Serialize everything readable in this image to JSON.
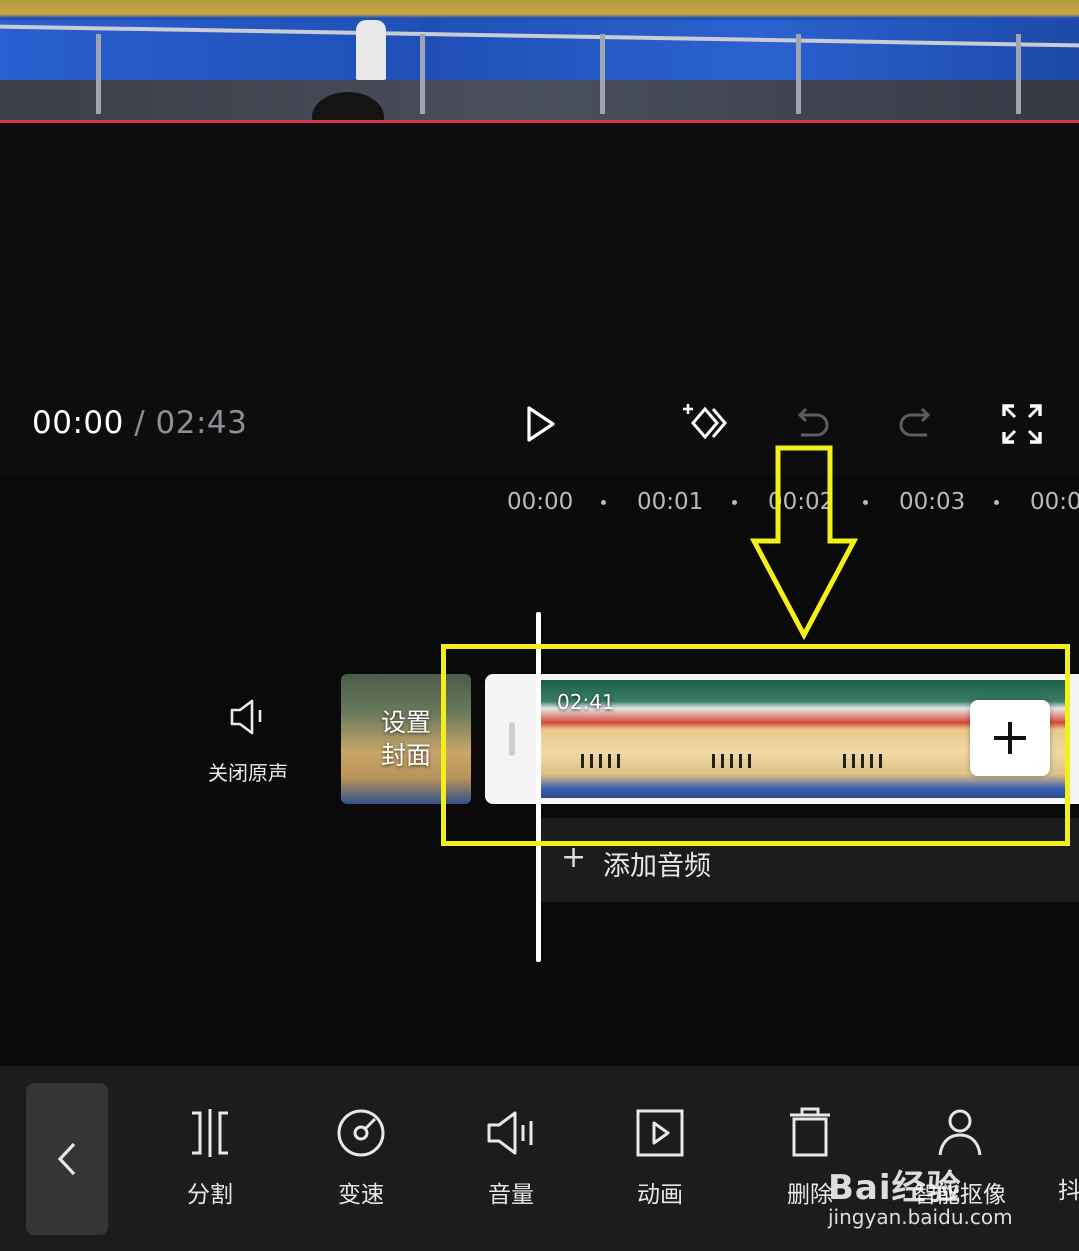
{
  "player": {
    "current_time": "00:00",
    "separator": " / ",
    "duration": "02:43"
  },
  "controls": [
    {
      "name": "play-icon"
    },
    {
      "name": "keyframe-icon"
    },
    {
      "name": "undo-icon"
    },
    {
      "name": "redo-icon"
    },
    {
      "name": "fullscreen-icon"
    }
  ],
  "ruler": {
    "ticks": [
      "00:00",
      "00:01",
      "00:02",
      "00:03",
      "00:0"
    ]
  },
  "track": {
    "mute_label": "关闭原声",
    "cover_label": "设置\n封面",
    "clip_duration": "02:41",
    "add_audio_label": "添加音频",
    "add_audio_plus": "+"
  },
  "toolbar": {
    "items": [
      {
        "label": "分割",
        "icon": "split-icon"
      },
      {
        "label": "变速",
        "icon": "speed-icon"
      },
      {
        "label": "音量",
        "icon": "volume-icon"
      },
      {
        "label": "动画",
        "icon": "animation-icon"
      },
      {
        "label": "删除",
        "icon": "delete-icon"
      },
      {
        "label": "智能抠像",
        "icon": "smart-cutout-icon"
      },
      {
        "label": "抖",
        "icon": ""
      }
    ]
  },
  "watermark": {
    "brand": "Bai经验",
    "site": "jingyan.baidu.com"
  },
  "colors": {
    "highlight": "#f3ef18",
    "progress_line": "#d8344a"
  }
}
